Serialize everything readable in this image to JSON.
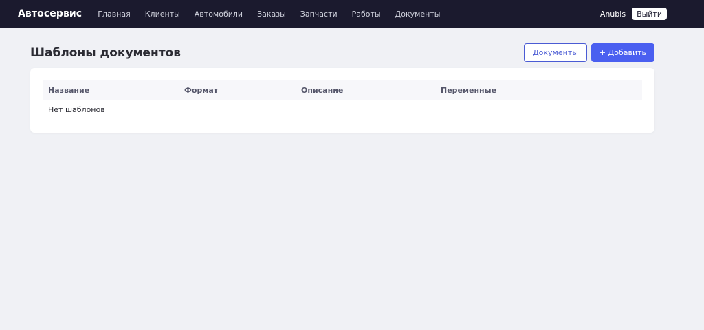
{
  "navbar": {
    "brand": "Автосервис",
    "links": [
      "Главная",
      "Клиенты",
      "Автомобили",
      "Заказы",
      "Запчасти",
      "Работы",
      "Документы"
    ],
    "user": "Anubis",
    "logout_label": "Выйти"
  },
  "page": {
    "title": "Шаблоны документов",
    "documents_button": "Документы",
    "add_button": "+ Добавить"
  },
  "table": {
    "columns": [
      "Название",
      "Формат",
      "Описание",
      "Переменные"
    ],
    "empty_text": "Нет шаблонов"
  },
  "colors": {
    "navbar_bg": "#1b1a2e",
    "accent": "#4a5ff0",
    "page_bg": "#f0f1f5"
  }
}
